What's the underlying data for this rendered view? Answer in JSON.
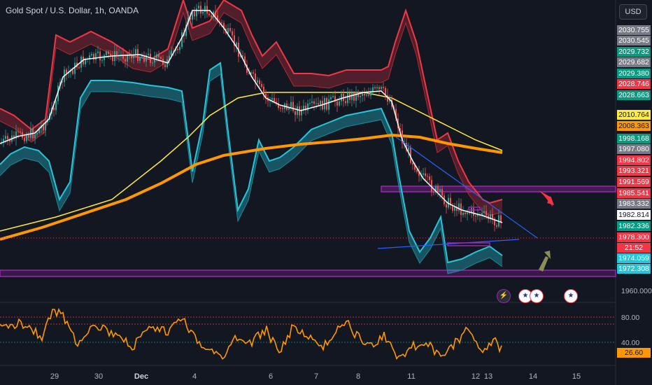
{
  "title": "Gold Spot / U.S. Dollar, 1h, OANDA",
  "currency": "USD",
  "event_icons": [
    "lightning-icon",
    "us-flag-icon",
    "us-flag-icon",
    "us-flag-icon"
  ],
  "price_labels": [
    {
      "text": "2030.755",
      "color": "#787b86"
    },
    {
      "text": "2030.545",
      "color": "#787b86"
    },
    {
      "text": "2029.732",
      "color": "#089981"
    },
    {
      "text": "2029.682",
      "color": "#787b86"
    },
    {
      "text": "2029.380",
      "color": "#089981"
    },
    {
      "text": "2028.746",
      "color": "#f23645"
    },
    {
      "text": "2028.663",
      "color": "#089981"
    },
    {
      "text": "2010.764",
      "color": "#ffeb3b"
    },
    {
      "text": "2008.363",
      "color": "#ff9800"
    },
    {
      "text": "1998.168",
      "color": "#089981"
    },
    {
      "text": "1997.080",
      "color": "#787b86"
    },
    {
      "text": "1994.802",
      "color": "#f23645"
    },
    {
      "text": "1993.321",
      "color": "#f23645"
    },
    {
      "text": "1991.569",
      "color": "#f23645"
    },
    {
      "text": "1985.541",
      "color": "#f23645"
    },
    {
      "text": "1983.332",
      "color": "#787b86"
    },
    {
      "text": "1982.814",
      "color": "#ffffff"
    },
    {
      "text": "1982.336",
      "color": "#089981"
    },
    {
      "text": "1978.300",
      "color": "#f23645"
    },
    {
      "text": "21:52",
      "color": "#f23645"
    },
    {
      "text": "1974.059",
      "color": "#26c6da"
    },
    {
      "text": "1972.308",
      "color": "#26c6da"
    }
  ],
  "axis_labels": {
    "price_1960": "1960.000",
    "osc_80": "80.00",
    "osc_40": "40.00",
    "osc_current": "26.60"
  },
  "x_labels": [
    {
      "text": "29",
      "bold": false
    },
    {
      "text": "30",
      "bold": false
    },
    {
      "text": "Dec",
      "bold": true
    },
    {
      "text": "4",
      "bold": false
    },
    {
      "text": "6",
      "bold": false
    },
    {
      "text": "7",
      "bold": false
    },
    {
      "text": "8",
      "bold": false
    },
    {
      "text": "11",
      "bold": false
    },
    {
      "text": "12",
      "bold": false
    },
    {
      "text": "13",
      "bold": false
    },
    {
      "text": "14",
      "bold": false
    },
    {
      "text": "15",
      "bold": false
    }
  ],
  "colors": {
    "background": "#131722",
    "upper_band": "#f23645",
    "lower_band": "#26c6da",
    "ma_fast": "#ffffff",
    "ma_mid": "#ffeb3b",
    "ma_slow": "#ff9800",
    "zone": "#9c27b0",
    "oscillator": "#ff9800"
  }
}
